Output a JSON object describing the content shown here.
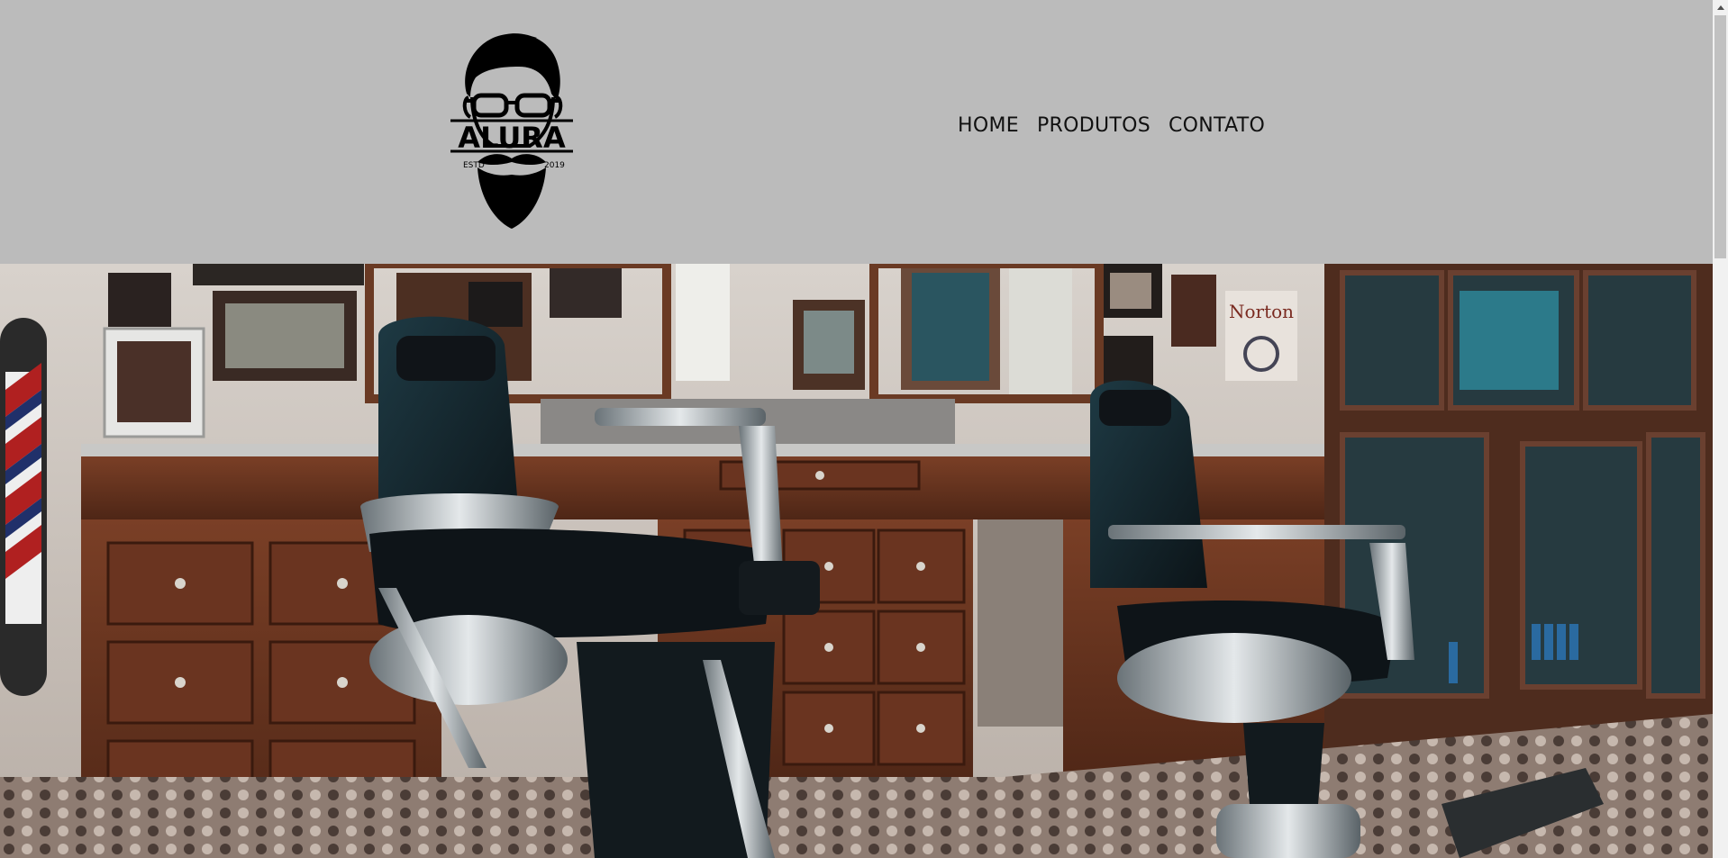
{
  "header": {
    "logo": {
      "icon": "bearded-man-glasses-logo-icon",
      "brand": "ALURA",
      "estd_left": "ESTD",
      "estd_right": "2019"
    },
    "nav": [
      {
        "label": "HOME"
      },
      {
        "label": "PRODUTOS"
      },
      {
        "label": "CONTATO"
      }
    ]
  },
  "hero": {
    "image": "barbershop-interior-photo",
    "poster_text": "Norton"
  },
  "colors": {
    "header_bg": "#bbbbbb",
    "nav_text": "#111111"
  }
}
